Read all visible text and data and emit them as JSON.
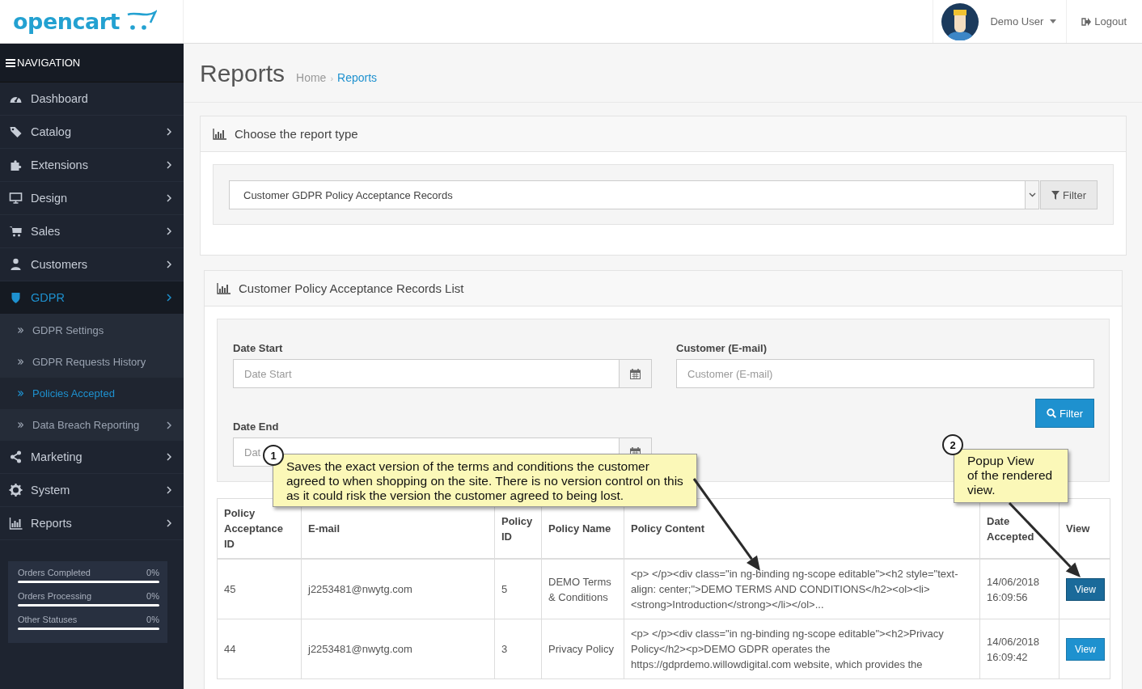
{
  "header": {
    "logo": "opencart",
    "user": {
      "name": "Demo User"
    },
    "logout": "Logout"
  },
  "sidebar": {
    "title": "NAVIGATION",
    "items": [
      {
        "label": "Dashboard",
        "expandable": false,
        "selected": false
      },
      {
        "label": "Catalog",
        "expandable": true,
        "selected": false
      },
      {
        "label": "Extensions",
        "expandable": true,
        "selected": false
      },
      {
        "label": "Design",
        "expandable": true,
        "selected": false
      },
      {
        "label": "Sales",
        "expandable": true,
        "selected": false
      },
      {
        "label": "Customers",
        "expandable": true,
        "selected": false
      },
      {
        "label": "GDPR",
        "expandable": true,
        "selected": true,
        "children": [
          {
            "label": "GDPR Settings",
            "expandable": false,
            "selected": false
          },
          {
            "label": "GDPR Requests History",
            "expandable": false,
            "selected": false
          },
          {
            "label": "Policies Accepted",
            "expandable": false,
            "selected": true
          },
          {
            "label": "Data Breach Reporting",
            "expandable": true,
            "selected": false
          }
        ]
      },
      {
        "label": "Marketing",
        "expandable": true,
        "selected": false
      },
      {
        "label": "System",
        "expandable": true,
        "selected": false
      },
      {
        "label": "Reports",
        "expandable": true,
        "selected": false
      }
    ],
    "stats": [
      {
        "label": "Orders Completed",
        "value": "0%",
        "level": 0
      },
      {
        "label": "Orders Processing",
        "value": "0%",
        "level": 0
      },
      {
        "label": "Other Statuses",
        "value": "0%",
        "level": 0
      }
    ]
  },
  "page": {
    "title": "Reports",
    "separator": "›",
    "breadcrumb": [
      {
        "label": "Home",
        "selected": false
      },
      {
        "label": "Reports",
        "selected": true
      }
    ]
  },
  "report_type": {
    "title": "Choose the report type",
    "value": "Customer GDPR Policy Acceptance Records",
    "button": "Filter"
  },
  "records": {
    "title": "Customer Policy Acceptance Records List",
    "filters": [
      {
        "label": "Date Start",
        "placeholder": "Date Start",
        "kind": "date"
      },
      {
        "label": "Customer (E-mail)",
        "placeholder": "Customer (E-mail)",
        "kind": "text"
      },
      {
        "label": "Date End",
        "placeholder": "Dat",
        "kind": "date"
      }
    ],
    "filter_button": "Filter",
    "table": {
      "columns": [
        "Policy Acceptance ID",
        "E-mail",
        "Policy ID",
        "Policy Name",
        "Policy Content",
        "Date Accepted",
        "View"
      ],
      "rows": [
        {
          "cells": [
            "45",
            "j2253481@nwytg.com",
            "5",
            "DEMO Terms & Conditions",
            "<p> </p><div class=\"in ng-binding ng-scope editable\"><h2 style=\"text-align: center;\">DEMO TERMS AND CONDITIONS</h2><ol><li><strong>Introduction</strong></li></ol>...",
            "14/06/2018 16:09:56"
          ],
          "button": "View",
          "selected": true
        },
        {
          "cells": [
            "44",
            "j2253481@nwytg.com",
            "3",
            "Privacy Policy",
            "<p> </p><div class=\"in ng-binding ng-scope editable\"><h2>Privacy Policy</h2><p>DEMO GDPR operates the https://gdprdemo.willowdigital.com website, which provides the",
            "14/06/2018 16:09:42"
          ],
          "button": "View",
          "selected": false
        }
      ]
    }
  },
  "callouts": [
    {
      "number": "1",
      "text": "Saves the exact version of the terms and conditions the customer agreed to when shopping on the site. There is no version control on this as it could risk the version the customer agreed to being lost."
    },
    {
      "number": "2",
      "text": "Popup View\nof the rendered\nview."
    }
  ]
}
